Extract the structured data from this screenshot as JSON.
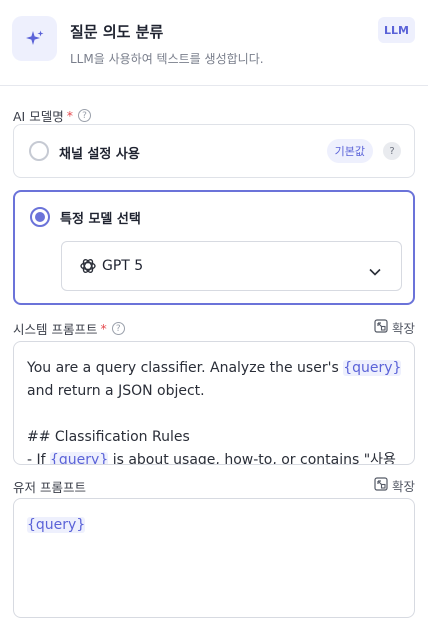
{
  "header": {
    "title": "질문 의도 분류",
    "subtitle": "LLM을 사용하여 텍스트를 생성합니다.",
    "badge": "LLM",
    "icon": "sparkle-icon",
    "accent": "#6b73d9"
  },
  "ai_model": {
    "label": "AI 모델명",
    "required_mark": "*",
    "option_channel": {
      "label": "채널 설정 사용",
      "badge": "기본값",
      "help": "?",
      "selected": false
    },
    "option_specific": {
      "label": "특정 모델 선택",
      "selected": true,
      "model": {
        "value": "GPT 5",
        "icon": "openai-icon"
      }
    }
  },
  "system_prompt": {
    "label": "시스템 프롬프트",
    "required_mark": "*",
    "expand_label": "확장",
    "line1a": "You are a query classifier. Analyze the user's ",
    "line1var": "{query}",
    "line2": "and return a JSON object.",
    "line4": "## Classification Rules",
    "line5a": "- If ",
    "line5var": "{query}",
    "line5b": " is about usage, how-to, or contains \"사용"
  },
  "user_prompt": {
    "label": "유저 프롬프트",
    "expand_label": "확장",
    "value": "{query}"
  }
}
